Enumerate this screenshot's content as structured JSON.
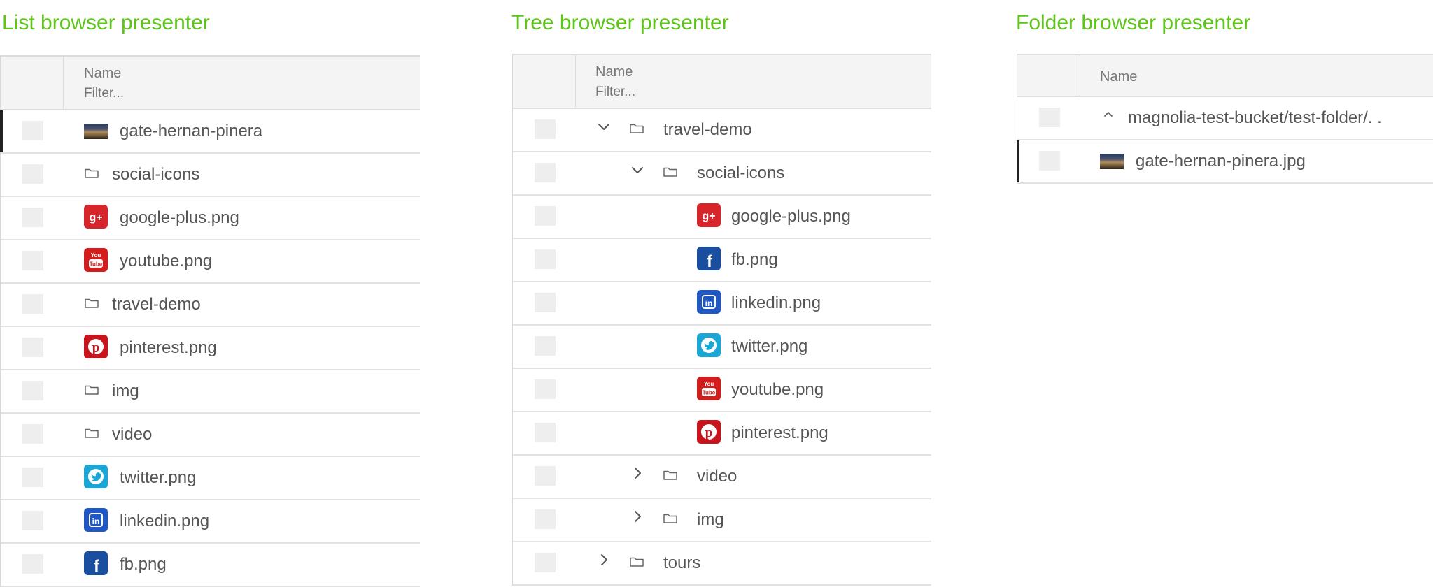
{
  "list": {
    "title": "List browser presenter",
    "header_name": "Name",
    "filter_placeholder": "Filter...",
    "rows": [
      {
        "label": "gate-hernan-pinera",
        "icon": "image-thumbnail-icon"
      },
      {
        "label": "social-icons",
        "icon": "folder-icon"
      },
      {
        "label": "google-plus.png",
        "icon": "google-plus-icon"
      },
      {
        "label": "youtube.png",
        "icon": "youtube-icon"
      },
      {
        "label": "travel-demo",
        "icon": "folder-icon"
      },
      {
        "label": "pinterest.png",
        "icon": "pinterest-icon"
      },
      {
        "label": "img",
        "icon": "folder-icon"
      },
      {
        "label": "video",
        "icon": "folder-icon"
      },
      {
        "label": "twitter.png",
        "icon": "twitter-icon"
      },
      {
        "label": "linkedin.png",
        "icon": "linkedin-icon"
      },
      {
        "label": "fb.png",
        "icon": "facebook-icon"
      }
    ]
  },
  "tree": {
    "title": "Tree browser presenter",
    "header_name": "Name",
    "filter_placeholder": "Filter...",
    "rows": [
      {
        "label": "travel-demo",
        "icon": "folder-icon",
        "toggle": "expanded"
      },
      {
        "label": "social-icons",
        "icon": "folder-icon",
        "toggle": "expanded"
      },
      {
        "label": "google-plus.png",
        "icon": "google-plus-icon"
      },
      {
        "label": "fb.png",
        "icon": "facebook-icon"
      },
      {
        "label": "linkedin.png",
        "icon": "linkedin-icon"
      },
      {
        "label": "twitter.png",
        "icon": "twitter-icon"
      },
      {
        "label": "youtube.png",
        "icon": "youtube-icon"
      },
      {
        "label": "pinterest.png",
        "icon": "pinterest-icon"
      },
      {
        "label": "video",
        "icon": "folder-icon",
        "toggle": "collapsed"
      },
      {
        "label": "img",
        "icon": "folder-icon",
        "toggle": "collapsed"
      },
      {
        "label": "tours",
        "icon": "folder-icon",
        "toggle": "collapsed"
      }
    ]
  },
  "folder": {
    "title": "Folder browser presenter",
    "header_name": "Name",
    "rows": [
      {
        "label": "magnolia-test-bucket/test-folder/. .",
        "icon": "chevron-up-icon"
      },
      {
        "label": "gate-hernan-pinera.jpg",
        "icon": "image-thumbnail-icon"
      }
    ]
  },
  "colors": {
    "title_green": "#5dc41a",
    "google_plus": "#d6262b",
    "youtube": "#d31c1c",
    "pinterest": "#c8151d",
    "twitter": "#1ba7d6",
    "linkedin": "#1f57c4",
    "facebook": "#1a4fa0"
  }
}
